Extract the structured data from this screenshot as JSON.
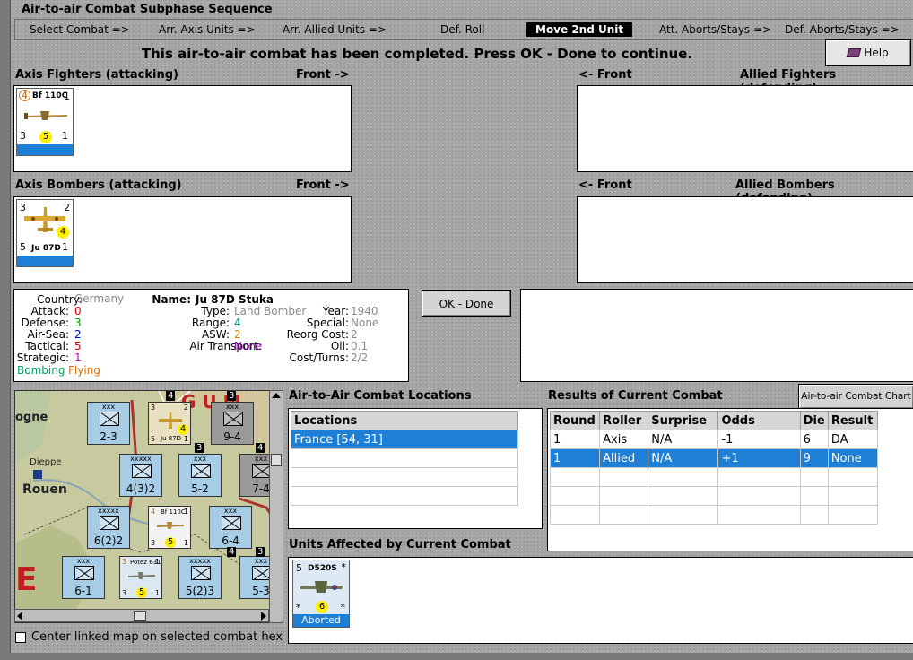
{
  "window": {
    "title": "Air-to-air Combat Subphase Sequence"
  },
  "sequence": [
    {
      "label": "Select Combat =>",
      "active": false
    },
    {
      "label": "Arr. Axis Units =>",
      "active": false
    },
    {
      "label": "Arr. Allied Units =>",
      "active": false
    },
    {
      "label": "Def. Roll",
      "active": false
    },
    {
      "label": "Move 2nd Unit",
      "active": true
    },
    {
      "label": "Att. Aborts/Stays =>",
      "active": false
    },
    {
      "label": "Def. Aborts/Stays =>",
      "active": false
    }
  ],
  "message": "This air-to-air combat has been completed.  Press OK - Done to continue.",
  "help_label": "Help",
  "panels": {
    "axis_fighters": {
      "title": "Axis Fighters (attacking)",
      "front": "Front ->"
    },
    "allied_fighters": {
      "title": "Allied Fighters (defending)",
      "front": "<- Front"
    },
    "axis_bombers": {
      "title": "Axis Bombers (attacking)",
      "front": "Front ->"
    },
    "allied_bombers": {
      "title": "Allied Bombers (defending)",
      "front": "<- Front"
    }
  },
  "counters": {
    "bf110": {
      "name": "Bf 110C",
      "top_left": "4",
      "top_right": "1",
      "bottom_left": "3",
      "dot": "5",
      "bottom_right": "1"
    },
    "ju87": {
      "name": "Ju 87D",
      "top_left": "3",
      "top_right": "2",
      "dot": "4",
      "bottom_left": "5",
      "bottom_right": "1"
    },
    "d520": {
      "name": "D520S",
      "top_left": "5",
      "dot": "6",
      "bl": "*",
      "br": "*",
      "tr": "*",
      "status": "Aborted"
    }
  },
  "unit_info": {
    "country_label": "Country:",
    "country": "Germany",
    "attack_label": "Attack:",
    "attack": "0",
    "defense_label": "Defense:",
    "defense": "3",
    "airsea_label": "Air-Sea:",
    "airsea": "2",
    "tactical_label": "Tactical:",
    "tactical": "5",
    "strategic_label": "Strategic:",
    "strategic": "1",
    "tag_bombing": "Bombing",
    "tag_flying": "Flying",
    "name_label": "Name:",
    "name": "Ju 87D Stuka",
    "type_label": "Type:",
    "type": "Land Bomber",
    "range_label": "Range:",
    "range": "4",
    "asw_label": "ASW:",
    "asw": "2",
    "air_transport_label": "Air Transport:",
    "air_transport": "None",
    "year_label": "Year:",
    "year": "1940",
    "special_label": "Special:",
    "special": "None",
    "reorg_label": "Reorg Cost:",
    "reorg": "2",
    "oil_label": "Oil:",
    "oil": "0.1",
    "cost_label": "Cost/Turns:",
    "cost": "2/2"
  },
  "colors": {
    "attack": "#e00000",
    "defense": "#009a00",
    "airsea": "#0000c8",
    "tactical": "#c80000",
    "strategic": "#d000d0",
    "bombing": "#00a060",
    "flying": "#e07000",
    "range": "#009090",
    "asw": "#e08000",
    "air_transport": "#8000a0",
    "selection": "#1e7fd6"
  },
  "ok_button": "OK - Done",
  "locations": {
    "title": "Air-to-Air Combat Locations",
    "header": "Locations",
    "rows": [
      "France [54, 31]"
    ]
  },
  "results": {
    "title": "Results of Current Combat",
    "chart_button": "Air-to-air Combat Chart",
    "headers": [
      "Round",
      "Roller",
      "Surprise",
      "Odds",
      "Die",
      "Result"
    ],
    "rows": [
      [
        "1",
        "Axis",
        "N/A",
        "-1",
        "6",
        "DA"
      ],
      [
        "1",
        "Allied",
        "N/A",
        "+1",
        "9",
        "None"
      ]
    ],
    "selected_row": 1
  },
  "units_affected_title": "Units Affected by Current Combat",
  "center_map_label": "Center linked map on selected combat hex",
  "map": {
    "labels": [
      "ogne",
      "Dieppe",
      "Rouen",
      "E",
      "G U M"
    ],
    "counters": [
      {
        "sz": "xxx",
        "val": "2-3"
      },
      {
        "sz": "xxx",
        "val": "9-4"
      },
      {
        "sz": "xxxxx",
        "val": "4(3)2"
      },
      {
        "sz": "xxx",
        "val": "5-2"
      },
      {
        "sz": "xxx",
        "val": "7-4"
      },
      {
        "sz": "xxxxx",
        "val": "6(2)2"
      },
      {
        "sz": "xxx",
        "val": "6-4"
      },
      {
        "sz": "xxx",
        "val": "6-1"
      },
      {
        "sz": "xxxxx",
        "val": "5(2)3"
      },
      {
        "sz": "xxx",
        "val": "5-3"
      }
    ],
    "air_counters": [
      {
        "name": "Ju 87D",
        "tl": "3",
        "tr": "2",
        "dot": "4",
        "bl": "5",
        "br": "1"
      },
      {
        "name": "Bf 110C",
        "tl": "4",
        "tr": "1",
        "dot": "5",
        "bl": "3",
        "br": "1"
      },
      {
        "name": "Potez 631",
        "tl": "3",
        "tr": "1",
        "dot": "5",
        "bl": "3",
        "br": "1"
      }
    ],
    "hex_numbers": [
      "4",
      "3",
      "4",
      "3",
      "4",
      "3"
    ]
  }
}
